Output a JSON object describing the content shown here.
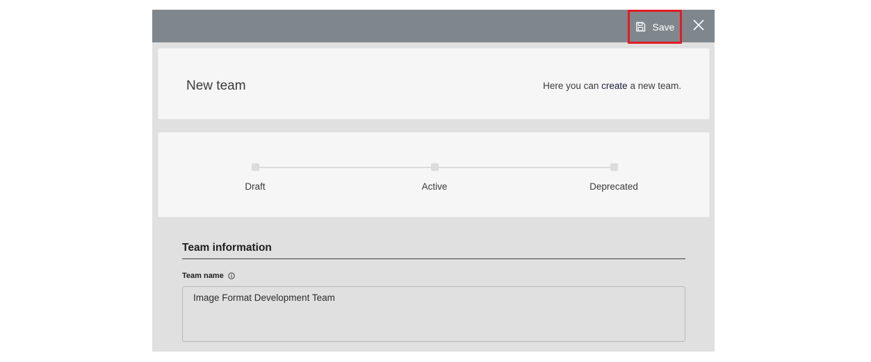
{
  "toolbar": {
    "save_label": "Save",
    "save_icon": "floppy-disk-icon",
    "close_icon": "close-icon",
    "background_color": "#7f878d",
    "highlight_color": "#e21b23"
  },
  "header": {
    "title": "New team",
    "description_prefix": "Here you can ",
    "description_emphasis": "create",
    "description_suffix": " a new team."
  },
  "status": {
    "steps": [
      {
        "label": "Draft"
      },
      {
        "label": "Active"
      },
      {
        "label": "Deprecated"
      }
    ]
  },
  "form": {
    "section_title": "Team information",
    "team_name": {
      "label": "Team name",
      "info_icon": "info-icon",
      "value": "Image Format Development Team"
    }
  }
}
